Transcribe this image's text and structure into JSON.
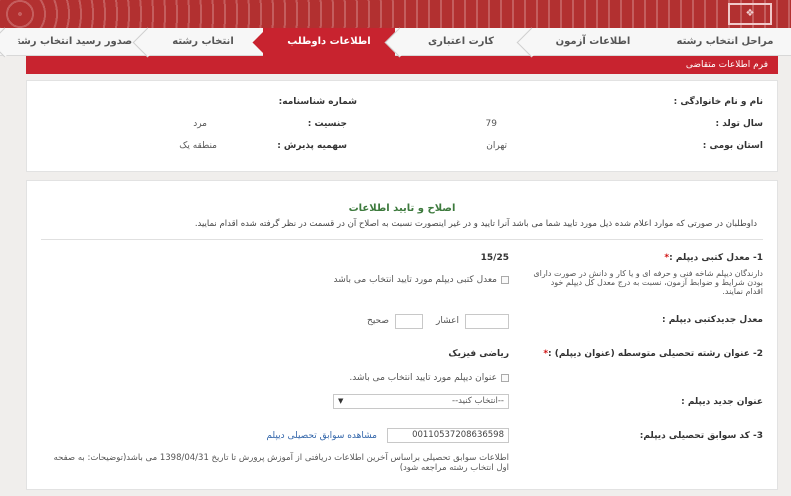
{
  "steps": [
    {
      "label": "مراحل انتخاب رشته",
      "active": false
    },
    {
      "label": "اطلاعات آزمون",
      "active": false
    },
    {
      "label": "کارت اعتباری",
      "active": false
    },
    {
      "label": "اطلاعات داوطلب",
      "active": true
    },
    {
      "label": "انتخاب رشته",
      "active": false
    },
    {
      "label": "صدور رسید انتخاب رشته",
      "active": false
    }
  ],
  "form_bar": "فرم اطلاعات متقاضی",
  "info": {
    "name_label": "نام و نام خانوادگی :",
    "cert_label": "شماره شناسنامه:",
    "birth_label": "سال تولد :",
    "birth_value": "79",
    "gender_label": "جنسیت :",
    "gender_value": "مرد",
    "province_label": "استان بومی :",
    "province_value": "تهران",
    "quota_label": "سهمیه پذیرش :",
    "quota_value": "منطقه یک"
  },
  "confirm": {
    "title": "اصلاح و تایید اطلاعات",
    "note": "داوطلبان در صورتی که موارد اعلام شده ذیل مورد تایید شما می باشد آنرا تایید و در غیر اینصورت نسبت به اصلاح آن در قسمت در نظر گرفته شده اقدام نمایید."
  },
  "q1": {
    "label": "1- معدل کتبی دیپلم :",
    "req": "*",
    "value": "15/25",
    "checkbox_label": "معدل کتبی دیپلم مورد تایید انتخاب می باشد",
    "desc": "دارندگان دیپلم شاخه فنی و حرفه ای و یا کار و دانش در صورت دارای بودن شرایط و ضوابط آزمون، نسبت به درج معدل کل دیپلم خود اقدام نمایند.",
    "new_label": "معدل جدیدکتبی دیپلم :",
    "decimal_label": "اعشار",
    "integer_label": "صحیح"
  },
  "q2": {
    "label": "2- عنوان رشته تحصیلی متوسطه (عنوان دیپلم) :",
    "req": "*",
    "value": "ریاضی فیزیک",
    "checkbox_label": "عنوان دیپلم مورد تایید انتخاب می باشد.",
    "new_label": "عنوان جدید دیپلم :",
    "select_value": "--انتخاب کنید--"
  },
  "q3": {
    "label": "3- کد سوابق تحصیلی دیپلم:",
    "value": "00110537208636598",
    "link": "مشاهده سوابق تحصیلی دیپلم",
    "note": "اطلاعات سوابق تحصیلی براساس آخرین اطلاعات دریافتی از آموزش پرورش تا تاریخ 1398/04/31 می باشد(توضیحات: به صفحه اول انتخاب رشته مراجعه شود)"
  }
}
